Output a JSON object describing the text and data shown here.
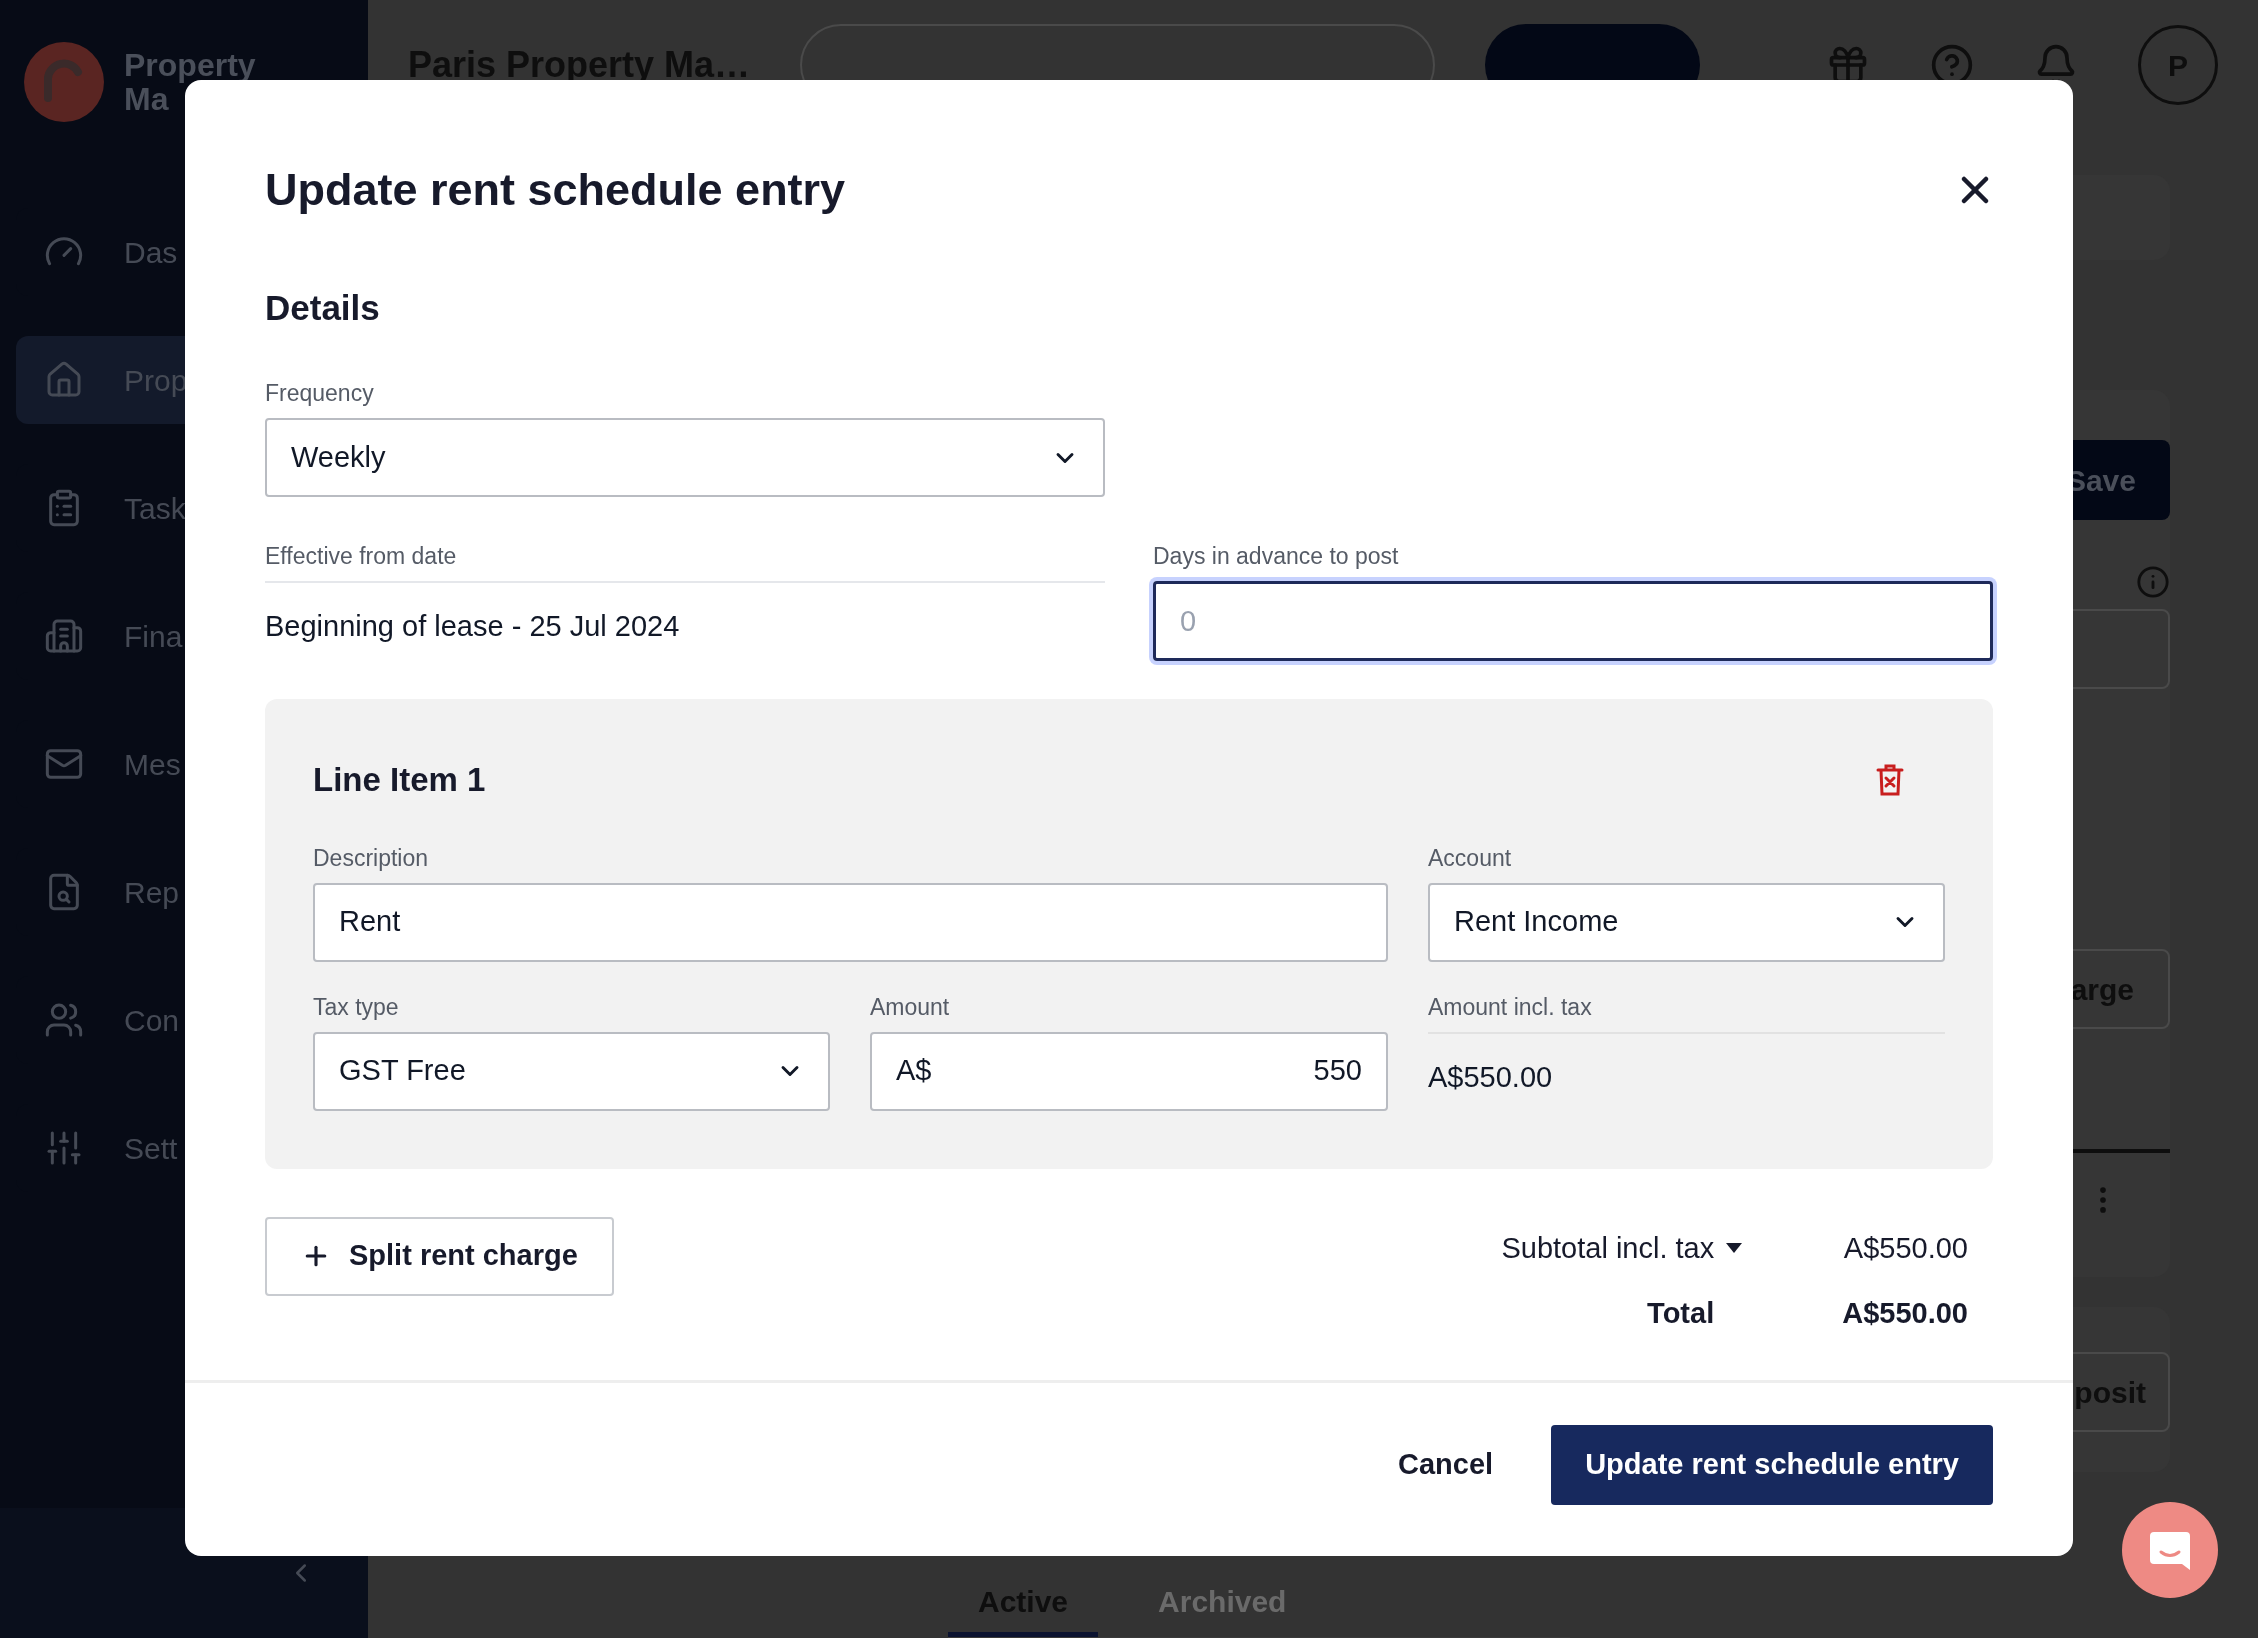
{
  "logo": {
    "line_1": "Property",
    "line_2": "Ma"
  },
  "sidebar": {
    "items": [
      {
        "label": "Das",
        "selected": false
      },
      {
        "label": "Prop",
        "selected": true
      },
      {
        "label": "Task",
        "selected": false
      },
      {
        "label": "Fina",
        "selected": false
      },
      {
        "label": "Mes",
        "selected": false
      },
      {
        "label": "Rep",
        "selected": false
      },
      {
        "label": "Con",
        "selected": false
      },
      {
        "label": "Sett",
        "selected": false
      }
    ]
  },
  "topbar": {
    "title": "Paris Property Ma…",
    "avatar": "P"
  },
  "background": {
    "save_button": "Save",
    "charge_button": "arge",
    "deposit_button": "posit",
    "tabs": [
      {
        "label": "Active",
        "selected": true
      },
      {
        "label": "Archived",
        "selected": false
      }
    ]
  },
  "modal": {
    "title": "Update rent schedule entry",
    "section": "Details",
    "frequency": {
      "label": "Frequency",
      "value": "Weekly"
    },
    "effective_from": {
      "label": "Effective from date",
      "value": "Beginning of lease - 25 Jul 2024"
    },
    "days_in_advance": {
      "label": "Days in advance to post",
      "placeholder": "0",
      "focused": true
    },
    "line_items": [
      {
        "title": "Line Item 1",
        "description": {
          "label": "Description",
          "value": "Rent"
        },
        "account": {
          "label": "Account",
          "value": "Rent Income"
        },
        "tax_type": {
          "label": "Tax type",
          "value": "GST Free"
        },
        "amount": {
          "label": "Amount",
          "prefix": "A$",
          "value": "550"
        },
        "amount_incl_tax": {
          "label": "Amount incl. tax",
          "value": "A$550.00"
        }
      }
    ],
    "split_button": "Split rent charge",
    "subtotal": {
      "label": "Subtotal incl. tax",
      "value": "A$550.00"
    },
    "total": {
      "label": "Total",
      "value": "A$550.00"
    },
    "cancel_button": "Cancel",
    "submit_button": "Update rent schedule entry"
  }
}
